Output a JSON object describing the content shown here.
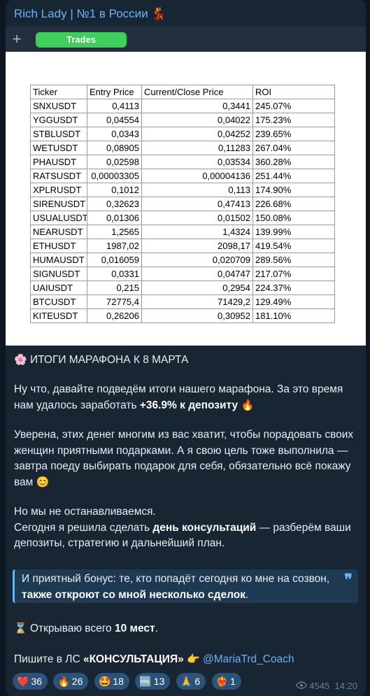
{
  "channel": {
    "title": "Rich Lady | №1 в России 💃"
  },
  "toolbar": {
    "plus_label": "+",
    "tab_label": "Trades"
  },
  "table": {
    "headers": [
      "Ticker",
      "Entry Price",
      "Current/Close Price",
      "ROI"
    ],
    "rows": [
      [
        "SNXUSDT",
        "0,4113",
        "0,3441",
        "245.07%"
      ],
      [
        "YGGUSDT",
        "0,04554",
        "0,04022",
        "175.23%"
      ],
      [
        "STBLUSDT",
        "0,0343",
        "0,04252",
        "239.65%"
      ],
      [
        "WETUSDT",
        "0,08905",
        "0,11283",
        "267.04%"
      ],
      [
        "PHAUSDT",
        "0,02598",
        "0,03534",
        "360.28%"
      ],
      [
        "RATSUSDT",
        "0,00003305",
        "0,00004136",
        "251.44%"
      ],
      [
        "XPLRUSDT",
        "0,1012",
        "0,113",
        "174.90%"
      ],
      [
        "SIRENUSDT",
        "0,32623",
        "0,47413",
        "226.68%"
      ],
      [
        "USUALUSDT",
        "0,01306",
        "0,01502",
        "150.08%"
      ],
      [
        "NEARUSDT",
        "1,2565",
        "1,4324",
        "139.99%"
      ],
      [
        "ETHUSDT",
        "1987,02",
        "2098,17",
        "419.54%"
      ],
      [
        "HUMAUSDT",
        "0,016059",
        "0,020709",
        "289.56%"
      ],
      [
        "SIGNUSDT",
        "0,0331",
        "0,04747",
        "217.07%"
      ],
      [
        "UAIUSDT",
        "0,215",
        "0,2954",
        "224.37%"
      ],
      [
        "BTCUSDT",
        "72775,4",
        "71429,2",
        "129.49%"
      ],
      [
        "KITEUSDT",
        "0,26206",
        "0,30952",
        "181.10%"
      ]
    ]
  },
  "post": {
    "heading_emoji": "🌸",
    "heading": "ИТОГИ МАРАФОНА К 8 МАРТА",
    "p1_text": "Ну что, давайте подведём итоги нашего марафона. За это время нам удалось заработать ",
    "p1_bold": "+36.9% к депозиту",
    "p1_emoji": "🔥",
    "p2_text": "Уверена, этих денег многим из вас хватит, чтобы порадовать своих женщин приятными подарками. А я свою цель тоже выполнила — завтра поеду выбирать подарок для себя, обязательно всё покажу вам",
    "p2_emoji": "😊",
    "p3_line1": "Но мы не останавливаемся.",
    "p3_pre": "Сегодня я решила сделать ",
    "p3_bold": "день консультаций",
    "p3_post": " — разберём ваши депозиты, стратегию и дальнейший план.",
    "quote_pre": "И приятный бонус: те, кто попадёт сегодня ко мне на созвон, ",
    "quote_bold": "также откроют со мной несколько сделок",
    "quote_post": ".",
    "quote_mark": "❞",
    "p4_emoji": "⌛",
    "p4_pre": " Открываю всего ",
    "p4_bold": "10 мест",
    "p4_post": ".",
    "p5_pre": "Пишите в ЛС ",
    "p5_bold": "«КОНСУЛЬТАЦИЯ»",
    "p5_emoji": "👉",
    "p5_link": "@MariaTrd_Coach"
  },
  "reactions": [
    {
      "emoji": "❤️",
      "count": "36"
    },
    {
      "emoji": "🔥",
      "count": "26"
    },
    {
      "emoji": "🤩",
      "count": "18"
    },
    {
      "emoji": "🆒",
      "count": "13"
    },
    {
      "emoji": "🙏",
      "count": "6"
    },
    {
      "emoji": "❤️‍🔥",
      "count": "1"
    }
  ],
  "meta": {
    "views": "4545",
    "time": "14:20",
    "views_icon": "eye-icon"
  }
}
